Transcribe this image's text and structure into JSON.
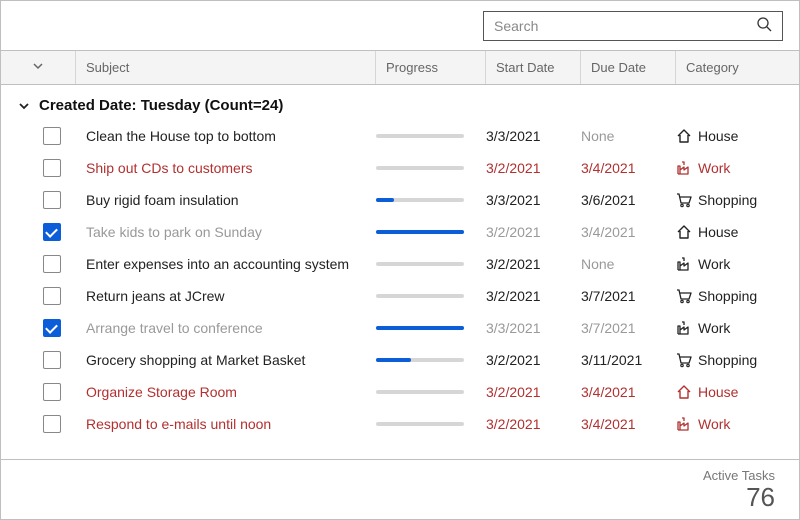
{
  "search": {
    "placeholder": "Search"
  },
  "columns": {
    "subject": "Subject",
    "progress": "Progress",
    "start_date": "Start Date",
    "due_date": "Due Date",
    "category": "Category"
  },
  "group": {
    "header": "Created Date: Tuesday (Count=24)"
  },
  "categories": {
    "house": {
      "label": "House",
      "icon": "house-icon"
    },
    "work": {
      "label": "Work",
      "icon": "factory-icon"
    },
    "shopping": {
      "label": "Shopping",
      "icon": "cart-icon"
    }
  },
  "tasks": [
    {
      "subject": "Clean the House top to bottom",
      "progress": 0,
      "start": "3/3/2021",
      "due": "None",
      "due_dim": true,
      "category": "house",
      "checked": false,
      "overdue": false
    },
    {
      "subject": "Ship out CDs to customers",
      "progress": 0,
      "start": "3/2/2021",
      "due": "3/4/2021",
      "category": "work",
      "checked": false,
      "overdue": true
    },
    {
      "subject": "Buy rigid foam insulation",
      "progress": 20,
      "start": "3/3/2021",
      "due": "3/6/2021",
      "category": "shopping",
      "checked": false,
      "overdue": false
    },
    {
      "subject": "Take kids to park on Sunday",
      "progress": 100,
      "start": "3/2/2021",
      "due": "3/4/2021",
      "category": "house",
      "checked": true,
      "overdue": false
    },
    {
      "subject": "Enter expenses into an accounting system",
      "progress": 0,
      "start": "3/2/2021",
      "due": "None",
      "due_dim": true,
      "category": "work",
      "checked": false,
      "overdue": false
    },
    {
      "subject": "Return jeans at JCrew",
      "progress": 0,
      "start": "3/2/2021",
      "due": "3/7/2021",
      "category": "shopping",
      "checked": false,
      "overdue": false
    },
    {
      "subject": "Arrange travel to conference",
      "progress": 100,
      "start": "3/3/2021",
      "due": "3/7/2021",
      "category": "work",
      "checked": true,
      "overdue": false
    },
    {
      "subject": "Grocery shopping at Market Basket",
      "progress": 40,
      "start": "3/2/2021",
      "due": "3/11/2021",
      "category": "shopping",
      "checked": false,
      "overdue": false
    },
    {
      "subject": "Organize Storage Room",
      "progress": 0,
      "start": "3/2/2021",
      "due": "3/4/2021",
      "category": "house",
      "checked": false,
      "overdue": true
    },
    {
      "subject": "Respond to e-mails until noon",
      "progress": 0,
      "start": "3/2/2021",
      "due": "3/4/2021",
      "category": "work",
      "checked": false,
      "overdue": true
    }
  ],
  "footer": {
    "label": "Active Tasks",
    "count": "76"
  }
}
